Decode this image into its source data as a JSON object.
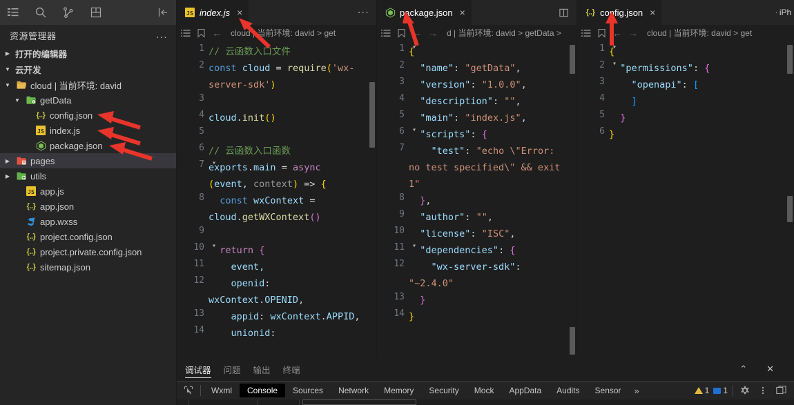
{
  "activity_bar": {
    "icons": [
      "explorer-icon",
      "search-icon",
      "source-control-icon",
      "save-icon",
      "collapse-sidebar-icon"
    ]
  },
  "sidebar": {
    "title": "资源管理器",
    "more_label": "...",
    "sections": [
      {
        "label": "打开的编辑器",
        "expanded": false
      },
      {
        "label": "云开发",
        "expanded": true
      }
    ],
    "tree": [
      {
        "label": "cloud | 当前环境: david",
        "icon": "folder-open-icon",
        "indent": 1,
        "caret": "down",
        "selected": false
      },
      {
        "label": "getData",
        "icon": "folder-cloud-icon",
        "indent": 2,
        "caret": "down",
        "selected": false
      },
      {
        "label": "config.json",
        "icon": "json-icon",
        "indent": 3,
        "caret": "none",
        "selected": false
      },
      {
        "label": "index.js",
        "icon": "js-icon",
        "indent": 3,
        "caret": "none",
        "selected": false
      },
      {
        "label": "package.json",
        "icon": "npm-icon",
        "indent": 3,
        "caret": "none",
        "selected": false
      },
      {
        "label": "pages",
        "icon": "folder-pages-icon",
        "indent": 1,
        "caret": "right",
        "selected": true
      },
      {
        "label": "utils",
        "icon": "folder-utils-icon",
        "indent": 1,
        "caret": "right",
        "selected": false
      },
      {
        "label": "app.js",
        "icon": "js-icon",
        "indent": 2,
        "caret": "none",
        "selected": false
      },
      {
        "label": "app.json",
        "icon": "json-icon",
        "indent": 2,
        "caret": "none",
        "selected": false
      },
      {
        "label": "app.wxss",
        "icon": "css-icon",
        "indent": 2,
        "caret": "none",
        "selected": false
      },
      {
        "label": "project.config.json",
        "icon": "json-icon",
        "indent": 2,
        "caret": "none",
        "selected": false
      },
      {
        "label": "project.private.config.json",
        "icon": "json-icon",
        "indent": 2,
        "caret": "none",
        "selected": false
      },
      {
        "label": "sitemap.json",
        "icon": "json-icon",
        "indent": 2,
        "caret": "none",
        "selected": false
      }
    ]
  },
  "editor_groups": [
    {
      "tab": {
        "name": "index.js",
        "icon": "js-icon",
        "close": "×",
        "italic": true,
        "active": true
      },
      "overflow": "...",
      "breadcrumb": {
        "path": "cloud | 当前环境: david  >  get",
        "back": "←",
        "forward": ""
      },
      "lines": [
        {
          "n": "1",
          "fold": "",
          "tokens": [
            {
              "t": "// 云函数入口文件",
              "c": "c-com"
            }
          ]
        },
        {
          "n": "2",
          "fold": "",
          "tokens": [
            {
              "t": "const",
              "c": "c-kw"
            },
            {
              "t": " ",
              "c": "c-pl"
            },
            {
              "t": "cloud",
              "c": "c-var"
            },
            {
              "t": " = ",
              "c": "c-op"
            },
            {
              "t": "require",
              "c": "c-fn"
            },
            {
              "t": "(",
              "c": "c-par"
            },
            {
              "t": "'wx-server-sdk'",
              "c": "c-str"
            },
            {
              "t": ")",
              "c": "c-par"
            }
          ]
        },
        {
          "n": "3",
          "fold": "",
          "tokens": []
        },
        {
          "n": "4",
          "fold": "",
          "tokens": [
            {
              "t": "cloud",
              "c": "c-var"
            },
            {
              "t": ".",
              "c": "c-op"
            },
            {
              "t": "init",
              "c": "c-fn"
            },
            {
              "t": "(",
              "c": "c-par"
            },
            {
              "t": ")",
              "c": "c-par"
            }
          ]
        },
        {
          "n": "5",
          "fold": "",
          "tokens": []
        },
        {
          "n": "6",
          "fold": "",
          "tokens": [
            {
              "t": "// 云函数入口函数",
              "c": "c-com"
            }
          ]
        },
        {
          "n": "7",
          "fold": "down",
          "tokens": [
            {
              "t": "exports",
              "c": "c-var"
            },
            {
              "t": ".",
              "c": "c-op"
            },
            {
              "t": "main",
              "c": "c-var"
            },
            {
              "t": " = ",
              "c": "c-op"
            },
            {
              "t": "async",
              "c": "c-kw2"
            },
            {
              "t": " ",
              "c": "c-pl"
            },
            {
              "t": "(",
              "c": "c-par"
            },
            {
              "t": "event",
              "c": "c-var"
            },
            {
              "t": ", ",
              "c": "c-op"
            },
            {
              "t": "context",
              "c": "c-prm"
            },
            {
              "t": ")",
              "c": "c-par"
            },
            {
              "t": " => ",
              "c": "c-op"
            },
            {
              "t": "{",
              "c": "c-par"
            }
          ]
        },
        {
          "n": "8",
          "fold": "",
          "tokens": [
            {
              "t": "  ",
              "c": "c-pl"
            },
            {
              "t": "const",
              "c": "c-kw"
            },
            {
              "t": " ",
              "c": "c-pl"
            },
            {
              "t": "wxContext",
              "c": "c-var"
            },
            {
              "t": " = ",
              "c": "c-op"
            },
            {
              "t": "cloud",
              "c": "c-var"
            },
            {
              "t": ".",
              "c": "c-op"
            },
            {
              "t": "getWXContext",
              "c": "c-fn"
            },
            {
              "t": "(",
              "c": "c-par2"
            },
            {
              "t": ")",
              "c": "c-par2"
            }
          ]
        },
        {
          "n": "9",
          "fold": "",
          "tokens": []
        },
        {
          "n": "10",
          "fold": "down",
          "tokens": [
            {
              "t": "  ",
              "c": "c-pl"
            },
            {
              "t": "return",
              "c": "c-kw2"
            },
            {
              "t": " ",
              "c": "c-pl"
            },
            {
              "t": "{",
              "c": "c-par2"
            }
          ]
        },
        {
          "n": "11",
          "fold": "",
          "tokens": [
            {
              "t": "    event,",
              "c": "c-var"
            }
          ]
        },
        {
          "n": "12",
          "fold": "",
          "tokens": [
            {
              "t": "    openid",
              "c": "c-var"
            },
            {
              "t": ": ",
              "c": "c-op"
            },
            {
              "t": "wxContext",
              "c": "c-var"
            },
            {
              "t": ".",
              "c": "c-op"
            },
            {
              "t": "OPENID",
              "c": "c-var"
            },
            {
              "t": ",",
              "c": "c-op"
            }
          ]
        },
        {
          "n": "13",
          "fold": "",
          "tokens": [
            {
              "t": "    appid",
              "c": "c-var"
            },
            {
              "t": ": ",
              "c": "c-op"
            },
            {
              "t": "wxContext",
              "c": "c-var"
            },
            {
              "t": ".",
              "c": "c-op"
            },
            {
              "t": "APPID",
              "c": "c-var"
            },
            {
              "t": ",",
              "c": "c-op"
            }
          ]
        },
        {
          "n": "14",
          "fold": "",
          "tokens": [
            {
              "t": "    unionid",
              "c": "c-var"
            },
            {
              "t": ":",
              "c": "c-op"
            }
          ]
        }
      ]
    },
    {
      "tab": {
        "name": "package.json",
        "icon": "npm-icon",
        "close": "×",
        "italic": false,
        "active": true
      },
      "overflow": "",
      "breadcrumb": {
        "path": "d | 当前环境: david  >  getData  >",
        "back": "←",
        "forward": "→"
      },
      "lines": [
        {
          "n": "1",
          "fold": "down",
          "tokens": [
            {
              "t": "{",
              "c": "c-par"
            }
          ]
        },
        {
          "n": "2",
          "fold": "",
          "tokens": [
            {
              "t": "  ",
              "c": "c-pl"
            },
            {
              "t": "\"name\"",
              "c": "c-key"
            },
            {
              "t": ": ",
              "c": "c-op"
            },
            {
              "t": "\"getData\"",
              "c": "c-str"
            },
            {
              "t": ",",
              "c": "c-op"
            }
          ]
        },
        {
          "n": "3",
          "fold": "",
          "tokens": [
            {
              "t": "  ",
              "c": "c-pl"
            },
            {
              "t": "\"version\"",
              "c": "c-key"
            },
            {
              "t": ": ",
              "c": "c-op"
            },
            {
              "t": "\"1.0.0\"",
              "c": "c-str"
            },
            {
              "t": ",",
              "c": "c-op"
            }
          ]
        },
        {
          "n": "4",
          "fold": "",
          "tokens": [
            {
              "t": "  ",
              "c": "c-pl"
            },
            {
              "t": "\"description\"",
              "c": "c-key"
            },
            {
              "t": ": ",
              "c": "c-op"
            },
            {
              "t": "\"\"",
              "c": "c-str"
            },
            {
              "t": ",",
              "c": "c-op"
            }
          ]
        },
        {
          "n": "5",
          "fold": "",
          "tokens": [
            {
              "t": "  ",
              "c": "c-pl"
            },
            {
              "t": "\"main\"",
              "c": "c-key"
            },
            {
              "t": ": ",
              "c": "c-op"
            },
            {
              "t": "\"index.js\"",
              "c": "c-str"
            },
            {
              "t": ",",
              "c": "c-op"
            }
          ]
        },
        {
          "n": "6",
          "fold": "down",
          "tokens": [
            {
              "t": "  ",
              "c": "c-pl"
            },
            {
              "t": "\"scripts\"",
              "c": "c-key"
            },
            {
              "t": ": ",
              "c": "c-op"
            },
            {
              "t": "{",
              "c": "c-par2"
            }
          ]
        },
        {
          "n": "7",
          "fold": "",
          "tokens": [
            {
              "t": "    ",
              "c": "c-pl"
            },
            {
              "t": "\"test\"",
              "c": "c-key"
            },
            {
              "t": ": ",
              "c": "c-op"
            },
            {
              "t": "\"echo \\\"Error: no test specified\\\" && exit 1\"",
              "c": "c-str"
            }
          ]
        },
        {
          "n": "8",
          "fold": "",
          "tokens": [
            {
              "t": "  ",
              "c": "c-pl"
            },
            {
              "t": "}",
              "c": "c-par2"
            },
            {
              "t": ",",
              "c": "c-op"
            }
          ]
        },
        {
          "n": "9",
          "fold": "",
          "tokens": [
            {
              "t": "  ",
              "c": "c-pl"
            },
            {
              "t": "\"author\"",
              "c": "c-key"
            },
            {
              "t": ": ",
              "c": "c-op"
            },
            {
              "t": "\"\"",
              "c": "c-str"
            },
            {
              "t": ",",
              "c": "c-op"
            }
          ]
        },
        {
          "n": "10",
          "fold": "",
          "tokens": [
            {
              "t": "  ",
              "c": "c-pl"
            },
            {
              "t": "\"license\"",
              "c": "c-key"
            },
            {
              "t": ": ",
              "c": "c-op"
            },
            {
              "t": "\"ISC\"",
              "c": "c-str"
            },
            {
              "t": ",",
              "c": "c-op"
            }
          ]
        },
        {
          "n": "11",
          "fold": "down",
          "tokens": [
            {
              "t": "  ",
              "c": "c-pl"
            },
            {
              "t": "\"dependencies\"",
              "c": "c-key"
            },
            {
              "t": ": ",
              "c": "c-op"
            },
            {
              "t": "{",
              "c": "c-par2"
            }
          ]
        },
        {
          "n": "12",
          "fold": "",
          "tokens": [
            {
              "t": "    ",
              "c": "c-pl"
            },
            {
              "t": "\"wx-server-sdk\"",
              "c": "c-key"
            },
            {
              "t": ": ",
              "c": "c-op"
            },
            {
              "t": "\"~2.4.0\"",
              "c": "c-str"
            }
          ]
        },
        {
          "n": "13",
          "fold": "",
          "tokens": [
            {
              "t": "  ",
              "c": "c-pl"
            },
            {
              "t": "}",
              "c": "c-par2"
            }
          ]
        },
        {
          "n": "14",
          "fold": "",
          "tokens": [
            {
              "t": "}",
              "c": "c-par"
            }
          ]
        }
      ]
    },
    {
      "tab": {
        "name": "config.json",
        "icon": "json-icon",
        "close": "×",
        "italic": false,
        "active": true
      },
      "overflow": "...",
      "breadcrumb": {
        "path": "cloud | 当前环境: david  >  get",
        "back": "←",
        "forward": "→"
      },
      "lines": [
        {
          "n": "1",
          "fold": "down",
          "tokens": [
            {
              "t": "{",
              "c": "c-par"
            }
          ]
        },
        {
          "n": "2",
          "fold": "down",
          "tokens": [
            {
              "t": "  ",
              "c": "c-pl"
            },
            {
              "t": "\"permissions\"",
              "c": "c-key"
            },
            {
              "t": ": ",
              "c": "c-op"
            },
            {
              "t": "{",
              "c": "c-par2"
            }
          ]
        },
        {
          "n": "3",
          "fold": "",
          "tokens": [
            {
              "t": "    ",
              "c": "c-pl"
            },
            {
              "t": "\"openapi\"",
              "c": "c-key"
            },
            {
              "t": ": ",
              "c": "c-op"
            },
            {
              "t": "[",
              "c": "c-par3"
            }
          ]
        },
        {
          "n": "4",
          "fold": "",
          "tokens": [
            {
              "t": "    ",
              "c": "c-pl"
            },
            {
              "t": "]",
              "c": "c-par3"
            }
          ]
        },
        {
          "n": "5",
          "fold": "",
          "tokens": [
            {
              "t": "  ",
              "c": "c-pl"
            },
            {
              "t": "}",
              "c": "c-par2"
            }
          ]
        },
        {
          "n": "6",
          "fold": "",
          "tokens": [
            {
              "t": "}",
              "c": "c-par"
            }
          ]
        }
      ]
    }
  ],
  "split_editor_label": "split-editor-icon",
  "device_label": "iPh",
  "panel": {
    "tabs": [
      {
        "label": "调试器",
        "active": true
      },
      {
        "label": "问题",
        "active": false
      },
      {
        "label": "输出",
        "active": false
      },
      {
        "label": "终端",
        "active": false
      }
    ],
    "collapse": "⌃",
    "close": "✕"
  },
  "devtools": {
    "inspect_icon": "inspect-element-icon",
    "tabs": [
      {
        "label": "Wxml",
        "active": false
      },
      {
        "label": "Console",
        "active": true
      },
      {
        "label": "Sources",
        "active": false
      },
      {
        "label": "Network",
        "active": false
      },
      {
        "label": "Memory",
        "active": false
      },
      {
        "label": "Security",
        "active": false
      },
      {
        "label": "Mock",
        "active": false
      },
      {
        "label": "AppData",
        "active": false
      },
      {
        "label": "Audits",
        "active": false
      },
      {
        "label": "Sensor",
        "active": false
      }
    ],
    "more": "»",
    "warnings": "1",
    "infos": "1",
    "settings_icon": "gear-icon",
    "kebab_icon": "kebab-menu-icon",
    "dock_icon": "dock-panel-icon"
  },
  "colors": {
    "background": "#1e1e1e",
    "sidebar": "#252526",
    "toolbar": "#333333",
    "selection": "#37373d",
    "annotation_arrow": "#e8342a",
    "warning": "#e2b93d",
    "info": "#1f6fd0"
  },
  "annotations": [
    {
      "name": "arrow-to-index-js-tab"
    },
    {
      "name": "arrow-to-config-json-tree"
    },
    {
      "name": "arrow-to-index-js-tree"
    },
    {
      "name": "arrow-to-package-json-tree"
    },
    {
      "name": "arrow-to-package-json-tab"
    },
    {
      "name": "arrow-to-config-json-tab"
    }
  ]
}
